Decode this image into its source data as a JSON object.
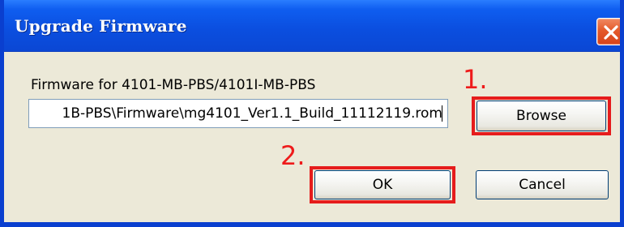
{
  "window": {
    "title": "Upgrade Firmware"
  },
  "firmware": {
    "label": "Firmware for 4101-MB-PBS/4101I-MB-PBS",
    "path_value": "1B-PBS\\Firmware\\mg4101_Ver1.1_Build_11112119.rom"
  },
  "buttons": {
    "browse": "Browse",
    "ok": "OK",
    "cancel": "Cancel"
  },
  "annotations": {
    "step1": "1.",
    "step2": "2."
  },
  "icons": {
    "close": "close-icon"
  },
  "colors": {
    "titlebar": "#0b4fe0",
    "dialog_background": "#ece9d8",
    "annotation_red": "#ee1b1b",
    "close_button": "#e45a2b"
  }
}
